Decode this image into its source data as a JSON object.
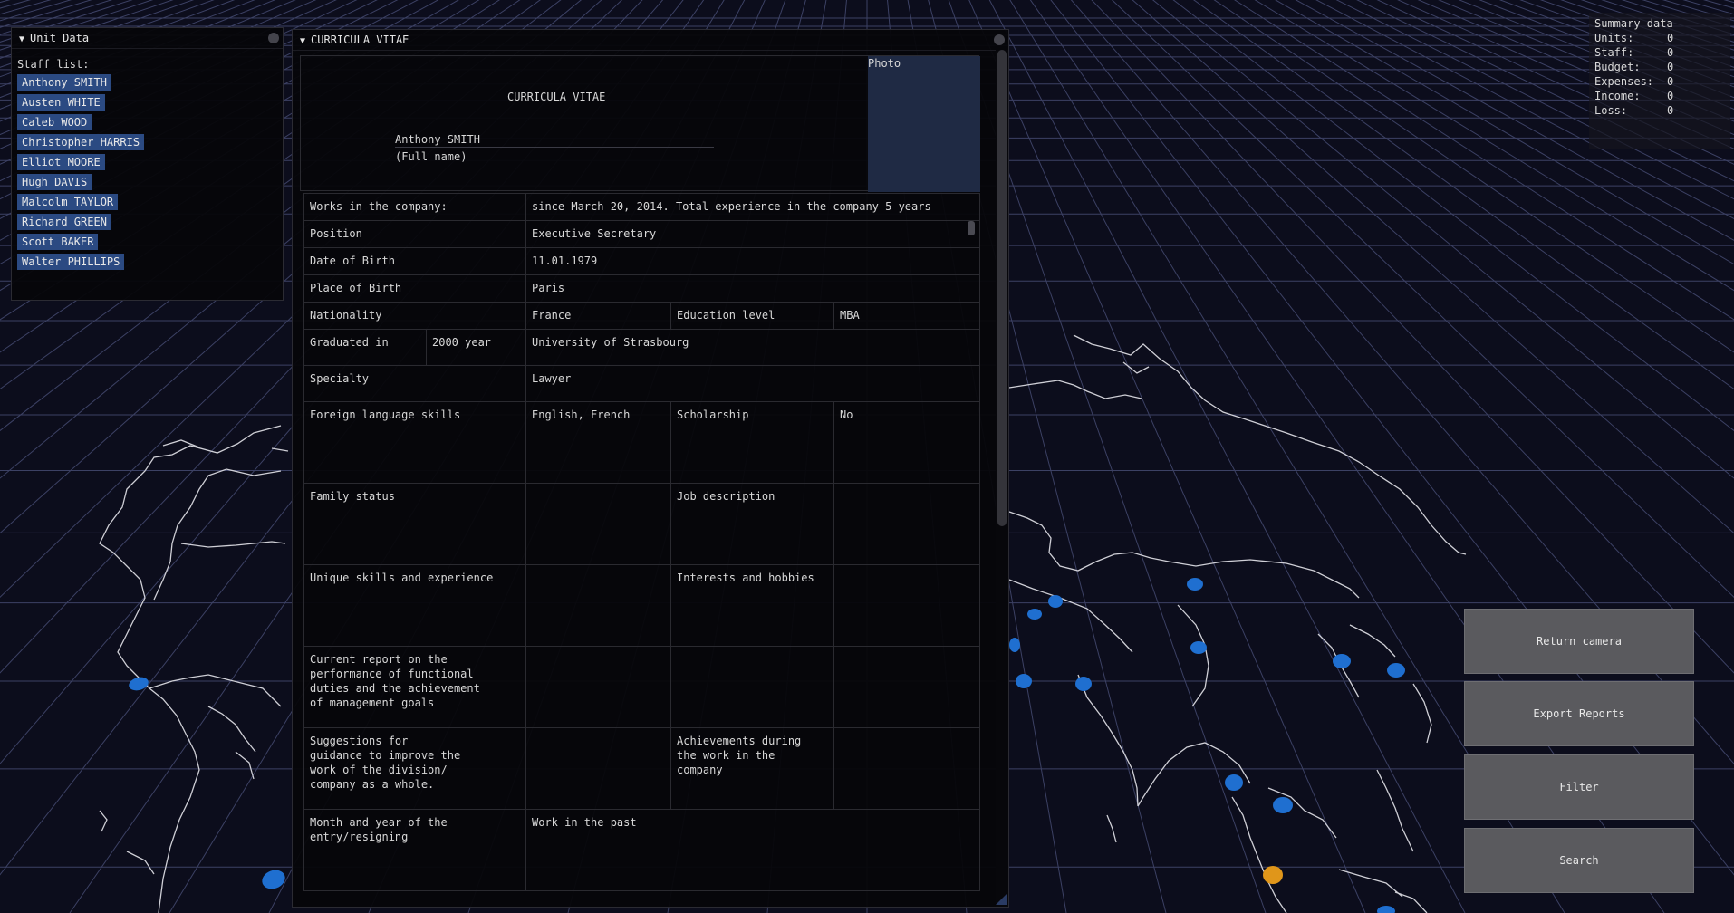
{
  "colors": {
    "background": "#0c0d1c",
    "grid": "#3c4164",
    "map_outline": "#cfcfd6",
    "marker_blue": "#1f6fd0",
    "marker_orange": "#e0961a",
    "staff_button": "#2b4a82",
    "action_button": "#5a5a5e"
  },
  "unit_window": {
    "title": "Unit Data",
    "staff_label": "Staff list:",
    "staff": [
      "Anthony SMITH",
      "Austen WHITE",
      "Caleb WOOD",
      "Christopher HARRIS",
      "Elliot MOORE",
      "Hugh DAVIS",
      "Malcolm TAYLOR",
      "Richard GREEN",
      "Scott BAKER",
      "Walter PHILLIPS"
    ]
  },
  "cv_window": {
    "title": "CURRICULA VITAE",
    "heading": "CURRICULA VITAE",
    "name": "Anthony SMITH",
    "full_name_label": "(Full name)",
    "photo_label": "Photo",
    "rows": {
      "works_label": "Works in the company:",
      "works_value": "since March 20, 2014. Total experience in the company 5 years",
      "position_label": "Position",
      "position_value": "Executive Secretary",
      "dob_label": "Date of Birth",
      "dob_value": "11.01.1979",
      "pob_label": "Place of Birth",
      "pob_value": "Paris",
      "nationality_label": "Nationality",
      "nationality_value": "France",
      "education_label": "Education level",
      "education_value": "MBA",
      "graduated_label": "Graduated in",
      "graduated_year": "2000 year",
      "graduated_value": "University of Strasbourg",
      "specialty_label": "Specialty",
      "specialty_value": "Lawyer",
      "languages_label": "Foreign language skills",
      "languages_value": "English, French",
      "scholarship_label": "Scholarship",
      "scholarship_value": "No",
      "family_label": "Family status",
      "job_desc_label": "Job description",
      "skills_label": "Unique skills and experience",
      "interests_label": "Interests and hobbies",
      "report_label": "Current report on the\nperformance of functional\nduties and the achievement\nof management goals",
      "suggestions_label": "Suggestions for\nguidance to improve the\nwork of the division/\ncompany as a whole.",
      "achievements_label": "Achievements during\nthe work in the\ncompany",
      "entry_label": "Month and year of the\nentry/resigning",
      "past_work_label": "Work in the past"
    }
  },
  "summary": {
    "title": "Summary data",
    "items": [
      {
        "label": "Units:",
        "value": "0"
      },
      {
        "label": "Staff:",
        "value": "0"
      },
      {
        "label": "Budget:",
        "value": "0"
      },
      {
        "label": "Expenses:",
        "value": "0"
      },
      {
        "label": "Income:",
        "value": "0"
      },
      {
        "label": "Loss:",
        "value": "0"
      }
    ]
  },
  "buttons": {
    "return_camera": "Return camera",
    "export_reports": "Export Reports",
    "filter": "Filter",
    "search": "Search"
  }
}
